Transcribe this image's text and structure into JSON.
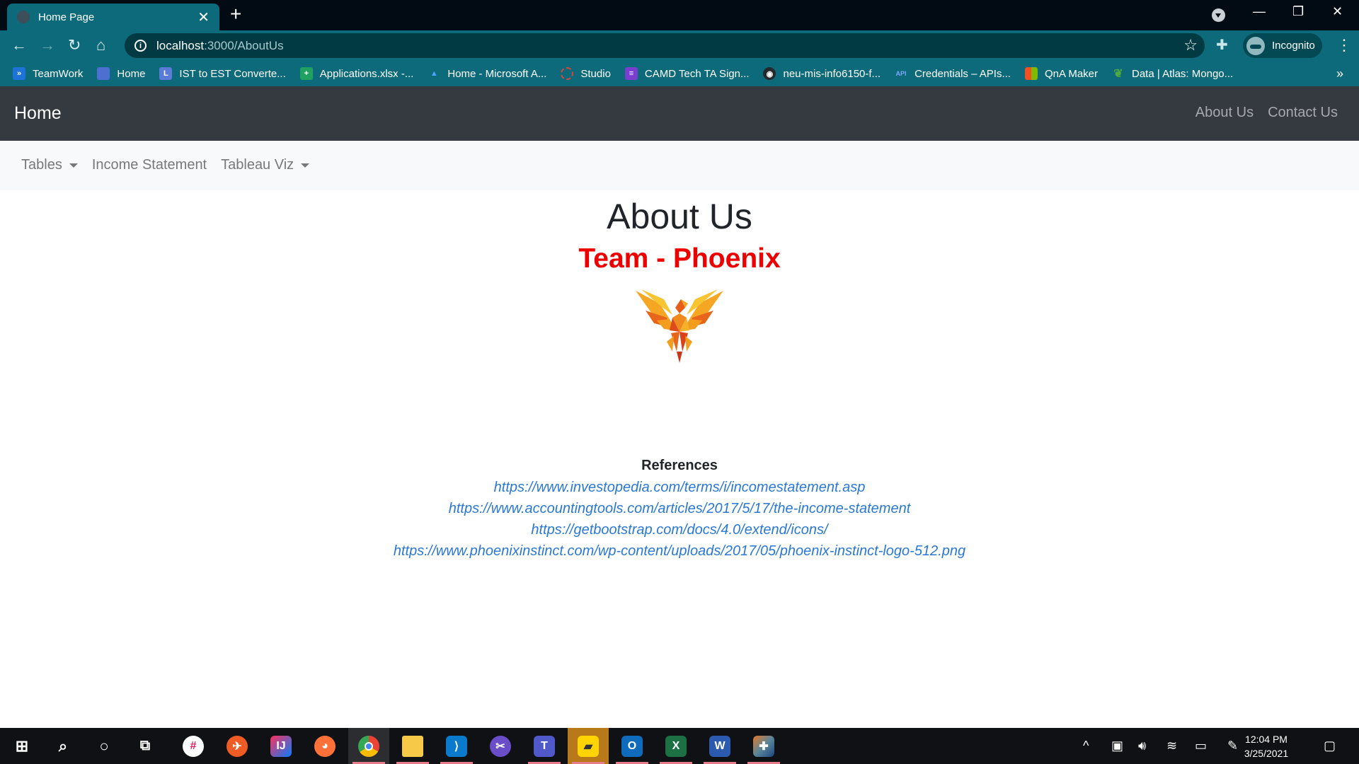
{
  "browser": {
    "tab_title": "Home Page",
    "new_tab": "+",
    "url_host": "localhost",
    "url_path": ":3000/AboutUs",
    "incognito_label": "Incognito",
    "bookmarks": [
      {
        "label": "TeamWork",
        "icon": "teamwork-icon",
        "color": "#1e73d8"
      },
      {
        "label": "Home",
        "icon": "page-icon",
        "color": "#4d6fd1"
      },
      {
        "label": "IST to EST Converte...",
        "icon": "clock-icon",
        "color": "#5b7bd9"
      },
      {
        "label": "Applications.xlsx -...",
        "icon": "sheets-icon",
        "color": "#20a162"
      },
      {
        "label": "Home - Microsoft A...",
        "icon": "azure-icon",
        "color": "#1e73d8"
      },
      {
        "label": "Studio",
        "icon": "studio-icon",
        "color": "#d9453c"
      },
      {
        "label": "CAMD Tech TA Sign...",
        "icon": "forms-icon",
        "color": "#7a3fd1"
      },
      {
        "label": "neu-mis-info6150-f...",
        "icon": "github-icon",
        "color": "#24292e"
      },
      {
        "label": "Credentials – APIs...",
        "icon": "api-icon",
        "color": "#4a7fe0"
      },
      {
        "label": "QnA Maker",
        "icon": "microsoft-icon",
        "color": "#f25022"
      },
      {
        "label": "Data | Atlas: Mongo...",
        "icon": "mongodb-icon",
        "color": "#4faa41"
      }
    ]
  },
  "navbar": {
    "brand": "Home",
    "right_links": [
      "About Us",
      "Contact Us"
    ],
    "left_items": [
      {
        "label": "Tables",
        "dropdown": true
      },
      {
        "label": "Income Statement",
        "dropdown": false
      },
      {
        "label": "Tableau Viz",
        "dropdown": true
      }
    ]
  },
  "content": {
    "title": "About Us",
    "team": "Team - Phoenix",
    "team_color": "#ec0000",
    "references_heading": "References",
    "references": [
      "https://www.investopedia.com/terms/i/incomestatement.asp",
      "https://www.accountingtools.com/articles/2017/5/17/the-income-statement",
      "https://getbootstrap.com/docs/4.0/extend/icons/",
      "https://www.phoenixinstinct.com/wp-content/uploads/2017/05/phoenix-instinct-logo-512.png"
    ]
  },
  "taskbar": {
    "time": "12:04 PM",
    "date": "3/25/2021"
  }
}
